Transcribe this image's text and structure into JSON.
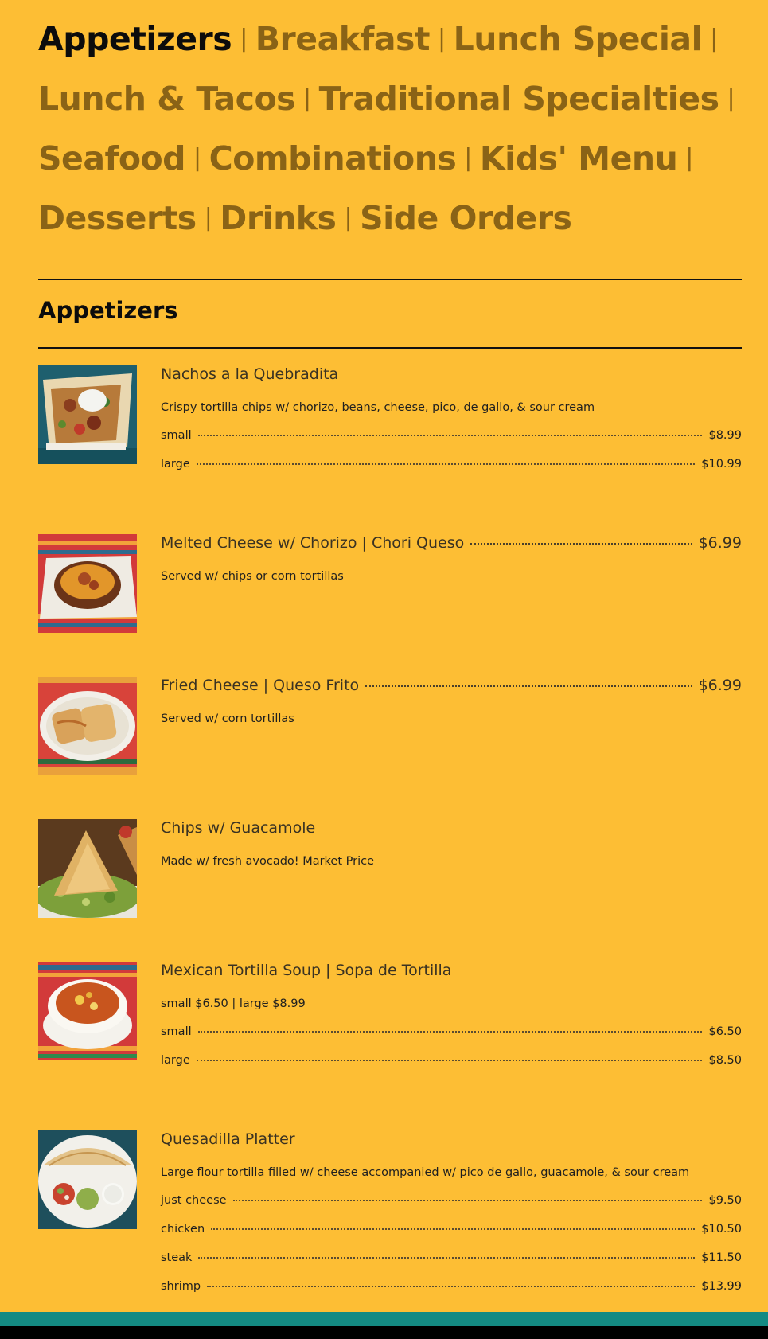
{
  "nav": {
    "links": [
      "Appetizers",
      "Breakfast",
      "Lunch Special",
      "Lunch & Tacos",
      "Traditional Specialties",
      "Seafood",
      "Combinations",
      "Kids' Menu",
      "Desserts",
      "Drinks",
      "Side Orders"
    ],
    "separator": "|",
    "active": "Appetizers"
  },
  "section": {
    "title": "Appetizers"
  },
  "items": [
    {
      "name": "Nachos a la Quebradita",
      "image": "nachos-photo",
      "description": "Crispy tortilla chips w/ chorizo, beans, cheese, pico, de gallo, & sour cream",
      "options": [
        {
          "label": "small",
          "price": "$8.99"
        },
        {
          "label": "large",
          "price": "$10.99"
        }
      ]
    },
    {
      "name": "Melted Cheese w/ Chorizo | Chori Queso",
      "price": "$6.99",
      "image": "chori-queso-photo",
      "description": "Served w/ chips or corn tortillas"
    },
    {
      "name": "Fried Cheese | Queso Frito",
      "price": "$6.99",
      "image": "queso-frito-photo",
      "description": "Served w/ corn tortillas"
    },
    {
      "name": "Chips w/ Guacamole",
      "image": "guacamole-photo",
      "description": "Made w/ fresh avocado! Market Price"
    },
    {
      "name": "Mexican Tortilla Soup | Sopa de Tortilla",
      "image": "tortilla-soup-photo",
      "description": "small $6.50 | large $8.99",
      "options": [
        {
          "label": "small",
          "price": "$6.50"
        },
        {
          "label": "large",
          "price": "$8.50"
        }
      ]
    },
    {
      "name": "Quesadilla Platter",
      "image": "quesadilla-photo",
      "description": "Large flour tortilla filled w/ cheese accompanied w/ pico de gallo, guacamole, & sour cream",
      "options": [
        {
          "label": "just cheese",
          "price": "$9.50"
        },
        {
          "label": "chicken",
          "price": "$10.50"
        },
        {
          "label": "steak",
          "price": "$11.50"
        },
        {
          "label": "shrimp",
          "price": "$13.99"
        }
      ]
    }
  ],
  "colors": {
    "background": "#FDBE34",
    "nav_inactive": "#8A6316",
    "nav_active": "#0C0C0C",
    "footer_teal": "#148A83",
    "footer_black": "#000000"
  }
}
